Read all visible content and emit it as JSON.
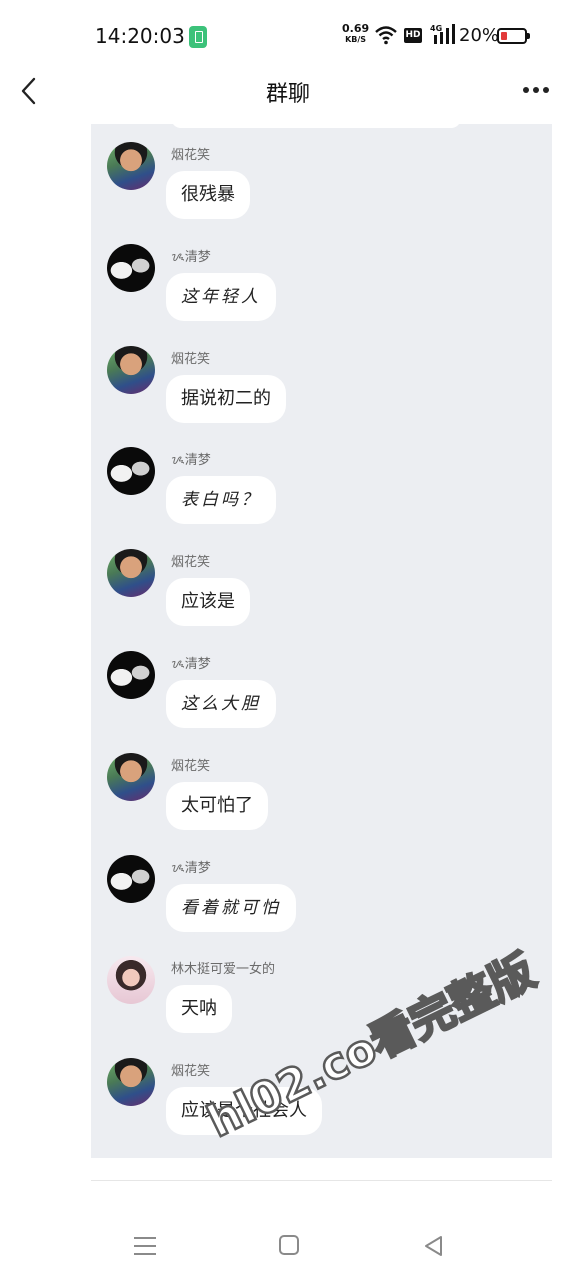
{
  "status_bar": {
    "time": "14:20:03",
    "net_speed_value": "0.69",
    "net_speed_unit": "KB/S",
    "hd_label": "HD",
    "network_label": "4G",
    "battery_percent": "20%"
  },
  "nav": {
    "title": "群聊"
  },
  "messages": [
    {
      "sender": "烟花笑",
      "text": "很残暴",
      "avatar": "yanhua"
    },
    {
      "sender": "ᝰ清梦",
      "text": "这年轻人",
      "avatar": "qingmeng"
    },
    {
      "sender": "烟花笑",
      "text": "据说初二的",
      "avatar": "yanhua"
    },
    {
      "sender": "ᝰ清梦",
      "text": "表白吗？",
      "avatar": "qingmeng"
    },
    {
      "sender": "烟花笑",
      "text": "应该是",
      "avatar": "yanhua"
    },
    {
      "sender": "ᝰ清梦",
      "text": "这么大胆",
      "avatar": "qingmeng"
    },
    {
      "sender": "烟花笑",
      "text": "太可怕了",
      "avatar": "yanhua"
    },
    {
      "sender": "ᝰ清梦",
      "text": "看着就可怕",
      "avatar": "qingmeng"
    },
    {
      "sender": "林木挺可爱一女的",
      "text": "天呐",
      "avatar": "linmu"
    },
    {
      "sender": "烟花笑",
      "text": "应该是个社会人",
      "avatar": "yanhua"
    }
  ],
  "watermark": "hl02.co看完整版",
  "colors": {
    "chat_background": "#eceef2",
    "bubble": "#ffffff",
    "sender_name": "#6b6b6b"
  },
  "icons": [
    "back-icon",
    "more-icon",
    "wifi-icon",
    "signal-icon",
    "battery-icon",
    "menu-icon",
    "home-icon",
    "back-triangle-icon"
  ]
}
